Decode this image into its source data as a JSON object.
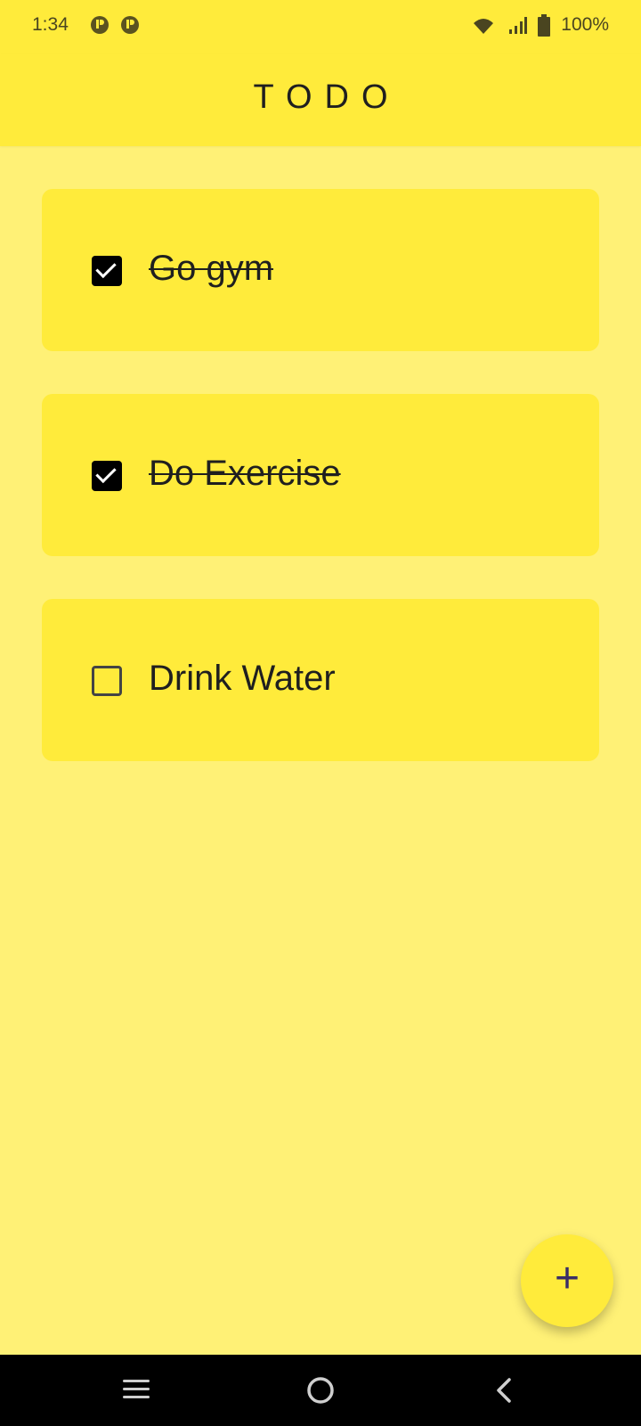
{
  "status_bar": {
    "time": "1:34",
    "battery": "100%",
    "icons": [
      "notification-icon",
      "notification-icon",
      "wifi-icon",
      "signal-icon",
      "battery-icon"
    ]
  },
  "app_bar": {
    "title": "TODO"
  },
  "todos": [
    {
      "label": "Go gym",
      "checked": true
    },
    {
      "label": "Do Exercise",
      "checked": true
    },
    {
      "label": "Drink Water",
      "checked": false
    }
  ],
  "fab": {
    "label": "+"
  },
  "nav_bar": {
    "icons": [
      "menu-icon",
      "home-icon",
      "back-icon"
    ]
  },
  "colors": {
    "background": "#fff176",
    "card": "#ffeb3b",
    "app_bar": "#ffeb3b",
    "nav_bar": "#000000"
  }
}
